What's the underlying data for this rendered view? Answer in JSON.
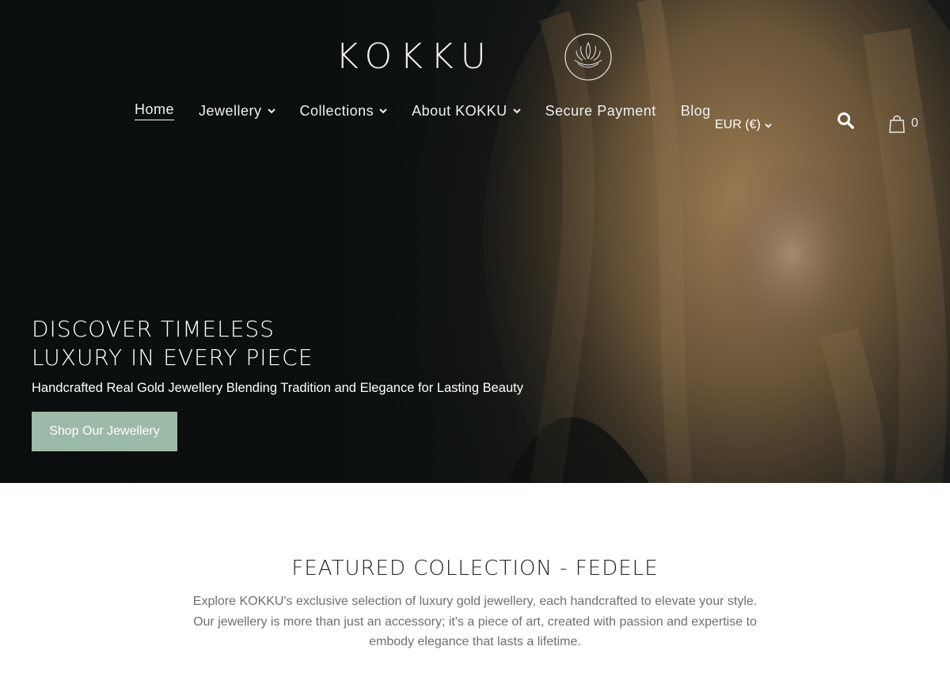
{
  "brand": {
    "name": "KOKKU"
  },
  "nav": {
    "items": [
      {
        "label": "Home",
        "dropdown": false,
        "active": true
      },
      {
        "label": "Jewellery",
        "dropdown": true
      },
      {
        "label": "Collections",
        "dropdown": true
      },
      {
        "label": "About KOKKU",
        "dropdown": true
      },
      {
        "label": "Secure Payment",
        "dropdown": false
      },
      {
        "label": "Blog",
        "dropdown": false
      }
    ]
  },
  "header": {
    "currency": "EUR (€)",
    "cart_count": "0",
    "icons": [
      "search-icon",
      "shopping-bag-icon",
      "chevron-down-icon"
    ]
  },
  "hero": {
    "title_line1": "DISCOVER TIMELESS",
    "title_line2": "LUXURY IN EVERY PIECE",
    "subtitle": "Handcrafted Real Gold Jewellery Blending Tradition and Elegance for Lasting Beauty",
    "cta_label": "Shop Our Jewellery"
  },
  "featured": {
    "title": "FEATURED COLLECTION - FEDELE",
    "text": "Explore KOKKU's exclusive selection of luxury gold jewellery, each handcrafted to elevate your style. Our jewellery is more than just an accessory; it's a piece of art, created with passion and expertise to embody elegance that lasts a lifetime."
  },
  "colors": {
    "hero_dark": "#121614",
    "cta_green": "#9cbaa8",
    "text_grey": "#6f6f6f"
  }
}
